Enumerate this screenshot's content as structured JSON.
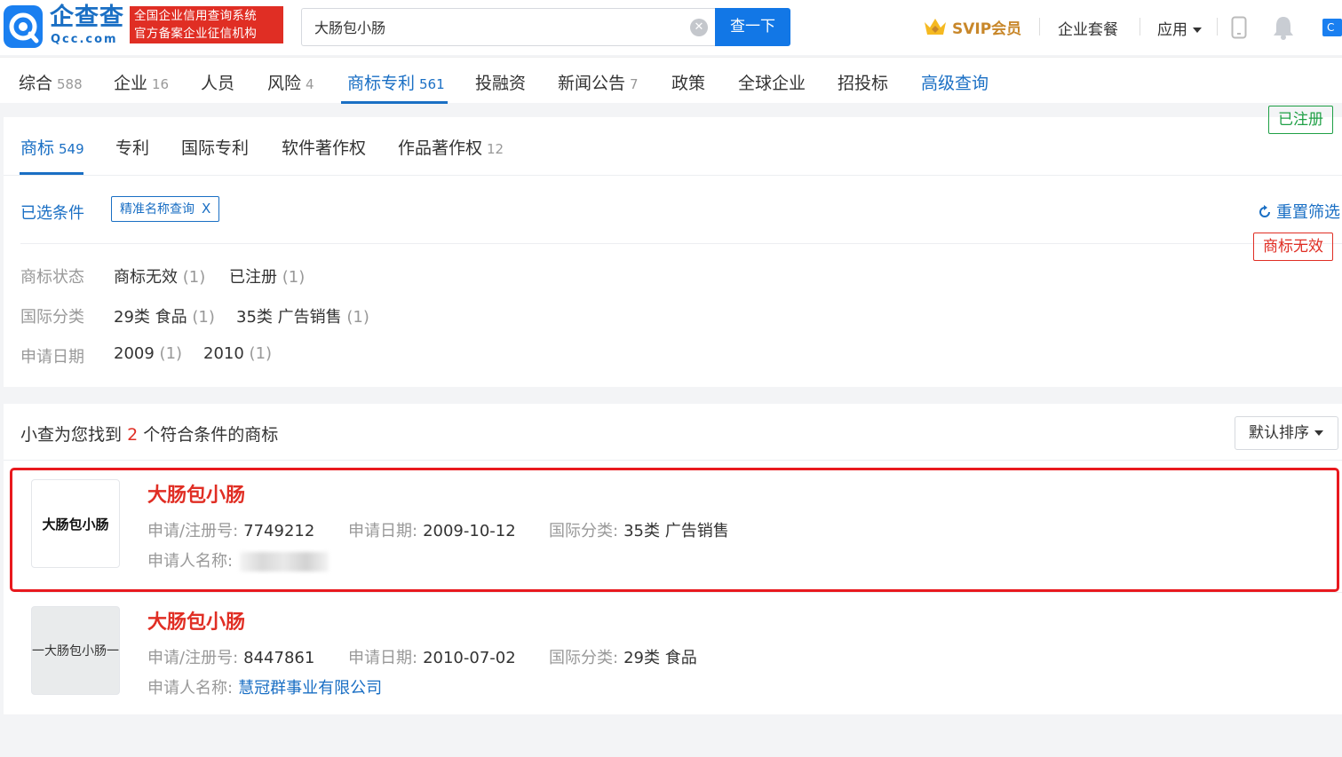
{
  "header": {
    "logo_text": "企查查",
    "logo_sub": "Qcc.com",
    "slogan_line1": "全国企业信用查询系统",
    "slogan_line2": "官方备案企业征信机构",
    "search_value": "大肠包小肠",
    "search_button": "查一下",
    "svip": "SVIP会员",
    "package": "企业套餐",
    "apps": "应用"
  },
  "tabs": [
    {
      "label": "综合",
      "count": "588"
    },
    {
      "label": "企业",
      "count": "16"
    },
    {
      "label": "人员",
      "count": ""
    },
    {
      "label": "风险",
      "count": "4"
    },
    {
      "label": "商标专利",
      "count": "561"
    },
    {
      "label": "投融资",
      "count": ""
    },
    {
      "label": "新闻公告",
      "count": "7"
    },
    {
      "label": "政策",
      "count": ""
    },
    {
      "label": "全球企业",
      "count": ""
    },
    {
      "label": "招投标",
      "count": ""
    },
    {
      "label": "高级查询",
      "count": ""
    }
  ],
  "subtabs": [
    {
      "label": "商标",
      "count": "549"
    },
    {
      "label": "专利",
      "count": ""
    },
    {
      "label": "国际专利",
      "count": ""
    },
    {
      "label": "软件著作权",
      "count": ""
    },
    {
      "label": "作品著作权",
      "count": "12"
    }
  ],
  "filters": {
    "selected_label": "已选条件",
    "tag": "精准名称查询",
    "tag_close": "X",
    "reset": "重置筛选",
    "rows": [
      {
        "label": "商标状态",
        "options": [
          {
            "text": "商标无效",
            "n": "(1)"
          },
          {
            "text": "已注册",
            "n": "(1)"
          }
        ]
      },
      {
        "label": "国际分类",
        "options": [
          {
            "text": "29类 食品",
            "n": "(1)"
          },
          {
            "text": "35类 广告销售",
            "n": "(1)"
          }
        ]
      },
      {
        "label": "申请日期",
        "options": [
          {
            "text": "2009",
            "n": "(1)"
          },
          {
            "text": "2010",
            "n": "(1)"
          }
        ]
      }
    ]
  },
  "results": {
    "prefix": "小查为您找到",
    "count": "2",
    "suffix": "个符合条件的商标",
    "sort": "默认排序",
    "items": [
      {
        "name": "大肠包小肠",
        "thumb": "大肠包小肠",
        "reg_label": "申请/注册号:",
        "reg_no": "7749212",
        "date_label": "申请日期:",
        "date": "2009-10-12",
        "class_label": "国际分类:",
        "class": "35类 广告销售",
        "applicant_label": "申请人名称:",
        "applicant": "",
        "status": "已注册"
      },
      {
        "name": "大肠包小肠",
        "thumb": "一大肠包小肠一",
        "reg_label": "申请/注册号:",
        "reg_no": "8447861",
        "date_label": "申请日期:",
        "date": "2010-07-02",
        "class_label": "国际分类:",
        "class": "29类 食品",
        "applicant_label": "申请人名称:",
        "applicant": "慧冠群事业有限公司",
        "status": "商标无效"
      }
    ]
  },
  "colors": {
    "brand": "#1a6fc4",
    "red": "#e02e24",
    "green": "#1fa046"
  }
}
